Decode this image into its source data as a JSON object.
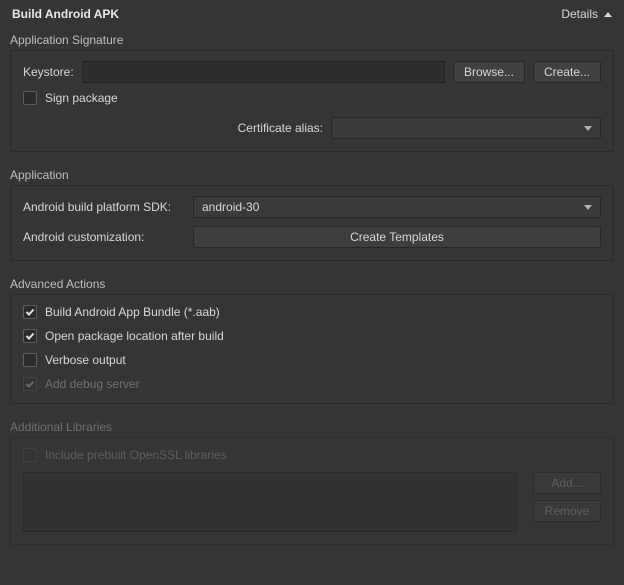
{
  "header": {
    "title": "Build Android APK",
    "details_label": "Details"
  },
  "signature": {
    "section_label": "Application Signature",
    "keystore_label": "Keystore:",
    "keystore_value": "",
    "browse_label": "Browse...",
    "create_label": "Create...",
    "sign_package_label": "Sign package",
    "sign_package_checked": false,
    "cert_alias_label": "Certificate alias:",
    "cert_alias_value": ""
  },
  "application": {
    "section_label": "Application",
    "sdk_label": "Android build platform SDK:",
    "sdk_value": "android-30",
    "customization_label": "Android customization:",
    "create_templates_label": "Create Templates"
  },
  "advanced": {
    "section_label": "Advanced Actions",
    "items": [
      {
        "label": "Build Android App Bundle (*.aab)",
        "checked": true,
        "disabled": false
      },
      {
        "label": "Open package location after build",
        "checked": true,
        "disabled": false
      },
      {
        "label": "Verbose output",
        "checked": false,
        "disabled": false
      },
      {
        "label": "Add debug server",
        "checked": true,
        "disabled": true
      }
    ]
  },
  "libraries": {
    "section_label": "Additional Libraries",
    "include_openssl_label": "Include prebuilt OpenSSL libraries",
    "include_openssl_checked": false,
    "add_label": "Add...",
    "remove_label": "Remove"
  }
}
